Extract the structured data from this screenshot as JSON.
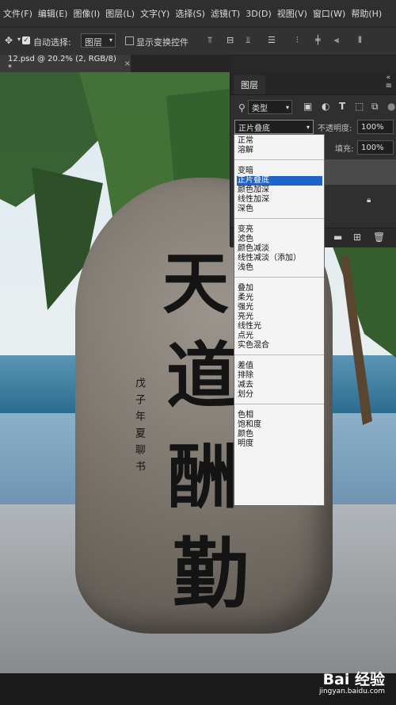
{
  "menu": [
    "文件(F)",
    "编辑(E)",
    "图像(I)",
    "图层(L)",
    "文字(Y)",
    "选择(S)",
    "滤镜(T)",
    "3D(D)",
    "视图(V)",
    "窗口(W)",
    "帮助(H)"
  ],
  "options": {
    "auto_select_label": "自动选择:",
    "auto_select_value": "图层",
    "show_transform_label": "显示变换控件"
  },
  "document_tab": {
    "title": "12.psd @ 20.2% (2, RGB/8) *",
    "close": "×"
  },
  "layers_panel": {
    "tab": "图层",
    "filter_kind": "类型",
    "blend_mode": "正片叠底",
    "opacity_label": "不透明度:",
    "opacity_value": "100%",
    "fill_label": "填充:",
    "fill_value": "100%"
  },
  "blend_menu": {
    "groups": [
      [
        "正常",
        "溶解"
      ],
      [
        "变暗",
        "正片叠底",
        "颜色加深",
        "线性加深",
        "深色"
      ],
      [
        "变亮",
        "滤色",
        "颜色减淡",
        "线性减淡（添加）",
        "浅色"
      ],
      [
        "叠加",
        "柔光",
        "强光",
        "亮光",
        "线性光",
        "点光",
        "实色混合"
      ],
      [
        "差值",
        "排除",
        "减去",
        "划分"
      ],
      [
        "色相",
        "饱和度",
        "颜色",
        "明度"
      ]
    ],
    "selected": "正片叠底"
  },
  "artwork": {
    "main_characters": [
      "天",
      "道",
      "酬",
      "勤"
    ],
    "side_inscription": "戊子年夏聊书"
  },
  "watermark": {
    "brand": "Bai 经验",
    "url": "jingyan.baidu.com"
  },
  "colors": {
    "selection": "#1f63c8",
    "panel": "#2f2f2f",
    "menubar": "#2f2f2f"
  }
}
